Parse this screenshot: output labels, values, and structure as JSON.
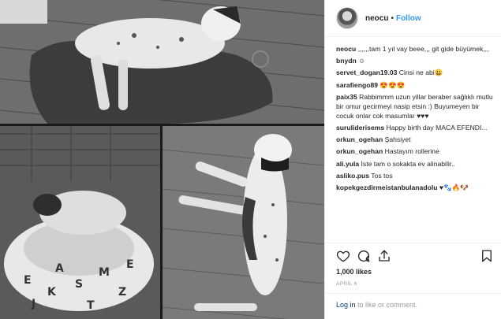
{
  "post": {
    "username": "neocu",
    "follow_label": "Follow",
    "separator": "•",
    "likes": "1,000 likes",
    "date": "APRIL 6"
  },
  "comments": [
    {
      "user": "neocu",
      "text": ",,,,,,tam 1 yıl vay beee,,, git gide büyümek,,,"
    },
    {
      "user": "bnydn",
      "text": "☺"
    },
    {
      "user": "servet_dogan19.03",
      "text": "Cinsi ne abi😃"
    },
    {
      "user": "sarafiengo89",
      "text": "😍😍😍"
    },
    {
      "user": "paix35",
      "text": "Rabbimmm uzun yillar beraber sağlıklı mutlu bir omur gecirmeyi nasip etsin :) Buyumeyen bir cocuk onlar cok masumlar ♥♥♥"
    },
    {
      "user": "suruliderisems",
      "text": "Happy birth day MACA EFENDI..."
    },
    {
      "user": "orkun_ogehan",
      "text": "Şahsiyet"
    },
    {
      "user": "orkun_ogehan",
      "text": "Hastayım rollerine"
    },
    {
      "user": "ali.yula",
      "text": "İste tam o sokakta ev alinabilir.."
    },
    {
      "user": "asliko.pus",
      "text": "Tos tos"
    },
    {
      "user": "kopekgezdirmeistanbulanadolu",
      "text": "♥🐾🔥🐶"
    }
  ],
  "footer": {
    "login_link": "Log in",
    "login_rest": " to like or comment."
  },
  "icons": {
    "like": "heart-icon",
    "comment": "comment-icon",
    "share": "share-icon",
    "save": "bookmark-icon"
  },
  "colors": {
    "link_blue": "#3897f0",
    "text": "#262626",
    "muted": "#999999"
  }
}
